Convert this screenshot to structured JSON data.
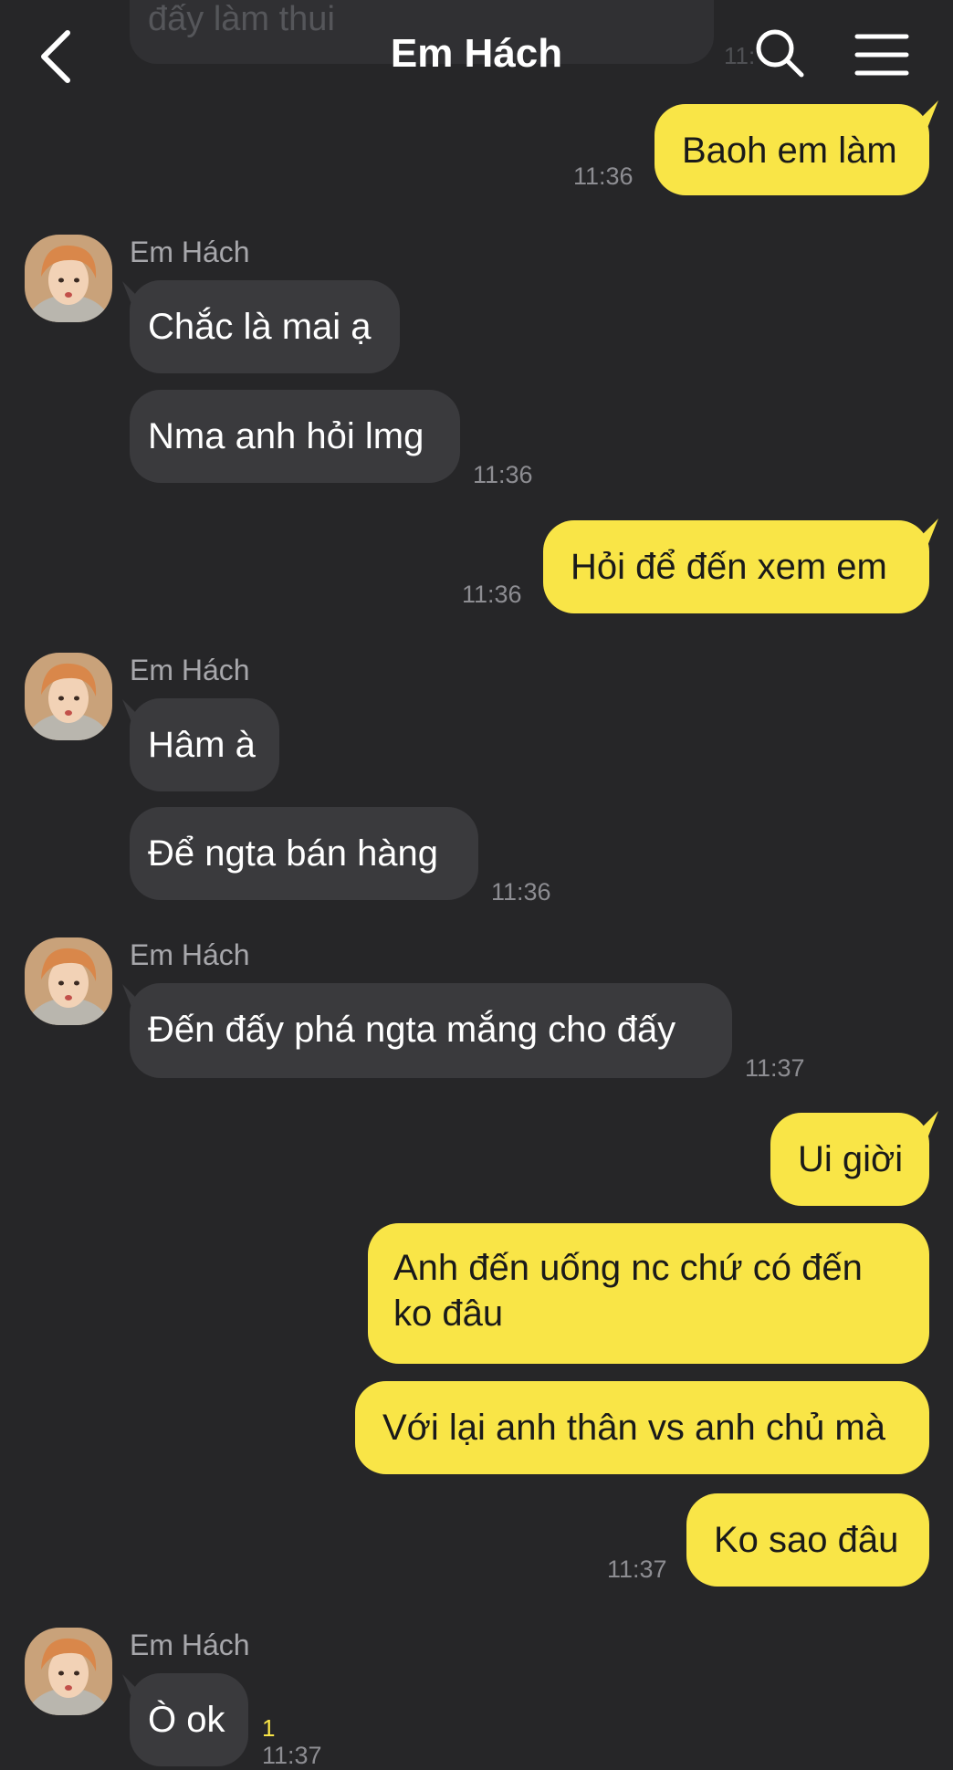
{
  "header": {
    "title": "Em Hách",
    "back_icon": "chevron-left-icon",
    "search_icon": "search-icon",
    "menu_icon": "hamburger-menu-icon"
  },
  "colors": {
    "background": "#262628",
    "incoming_bubble": "#3a3a3d",
    "outgoing_bubble": "#f9e547",
    "unread": "#f9e547"
  },
  "ghost": {
    "text": "đấy làm thui",
    "time": "11:"
  },
  "messages": [
    {
      "dir": "out",
      "text": "Baoh em làm",
      "time": "11:36"
    },
    {
      "dir": "in",
      "sender": "Em Hách",
      "text": "Chắc là mai ạ"
    },
    {
      "dir": "in",
      "text": "Nma anh hỏi lmg",
      "time": "11:36"
    },
    {
      "dir": "out",
      "text": "Hỏi để đến xem em",
      "time": "11:36"
    },
    {
      "dir": "in",
      "sender": "Em Hách",
      "text": "Hâm à"
    },
    {
      "dir": "in",
      "text": "Để ngta bán hàng",
      "time": "11:36"
    },
    {
      "dir": "in",
      "sender": "Em Hách",
      "text": "Đến đấy phá ngta mắng cho đấy",
      "time": "11:37"
    },
    {
      "dir": "out",
      "text": "Ui giời"
    },
    {
      "dir": "out",
      "text": "Anh đến uống nc chứ có đến ko đâu"
    },
    {
      "dir": "out",
      "text": "Với lại anh thân vs anh chủ mà"
    },
    {
      "dir": "out",
      "text": "Ko sao đâu",
      "time": "11:37"
    },
    {
      "dir": "in",
      "sender": "Em Hách",
      "text": "Ò ok",
      "unread": "1",
      "time": "11:37"
    }
  ]
}
